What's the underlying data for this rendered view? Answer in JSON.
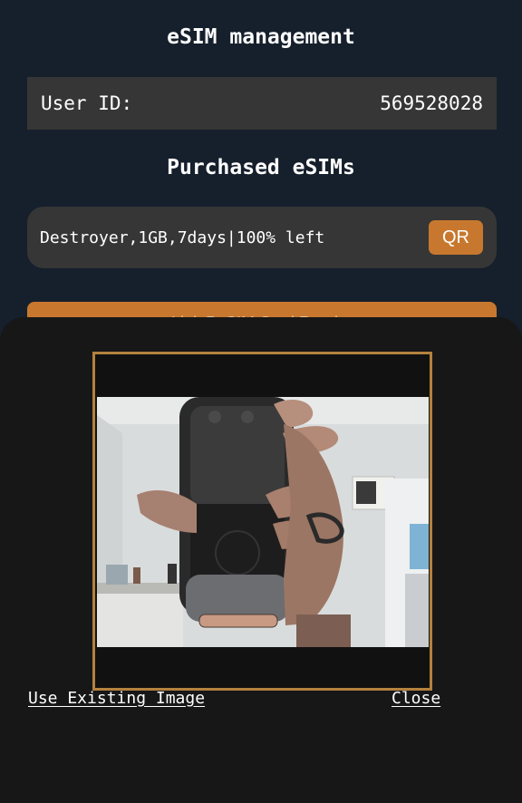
{
  "page": {
    "title": "eSIM management"
  },
  "user": {
    "label": "User ID:",
    "value": "569528028"
  },
  "purchased": {
    "title": "Purchased eSIMs",
    "items": [
      {
        "description": "Destroyer,1GB,7days|100% left",
        "qr_label": "QR"
      }
    ]
  },
  "actions": {
    "link_button_label": "Link PoSIM Card Reader"
  },
  "scanner": {
    "use_existing_label": "Use Existing Image",
    "close_label": "Close"
  },
  "colors": {
    "background": "#16202c",
    "card": "#363636",
    "accent": "#c8782e",
    "sheet": "#171717",
    "scan_frame": "#b4813d"
  },
  "icons": {
    "camera_feed": "camera-preview-image"
  }
}
